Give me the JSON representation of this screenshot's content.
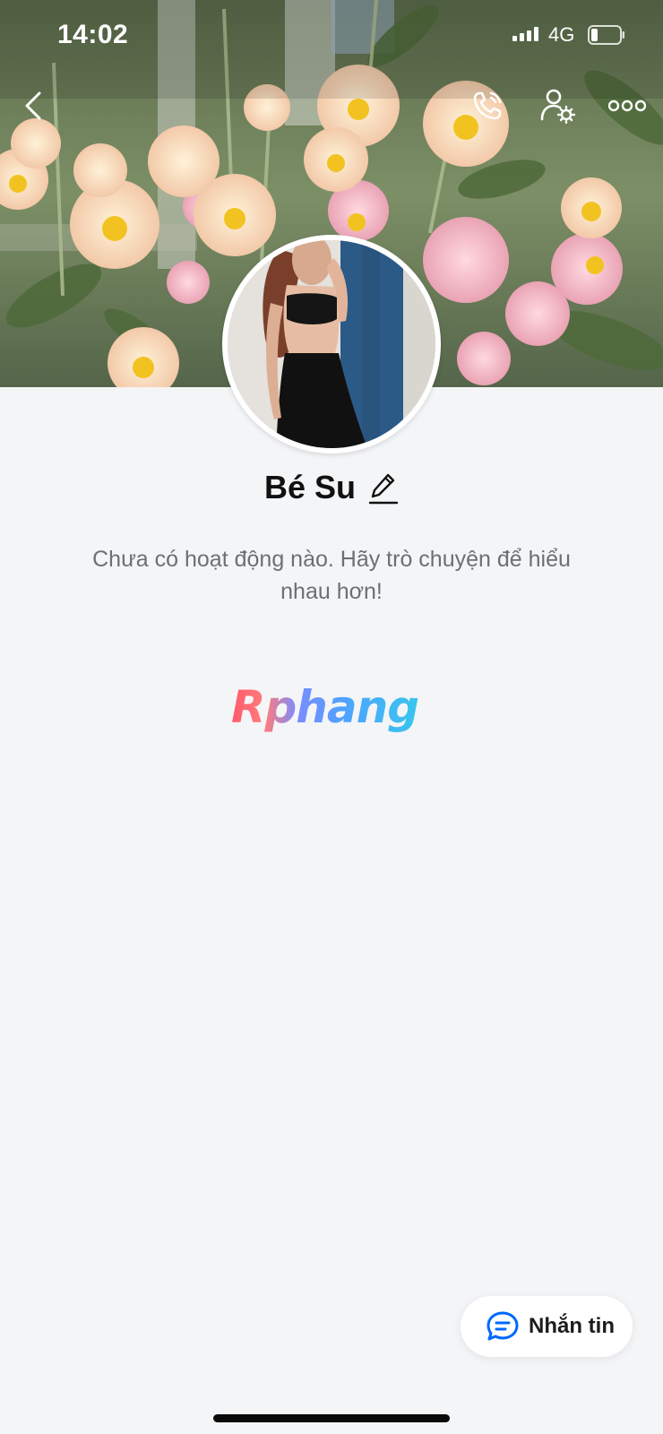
{
  "status_bar": {
    "time": "14:02",
    "network": "4G"
  },
  "nav": {
    "back_icon": "chevron-left-icon",
    "call_icon": "phone-icon",
    "friend_settings_icon": "user-gear-icon",
    "more_icon": "more-dots-icon"
  },
  "profile": {
    "name": "Bé Su",
    "edit_icon": "pencil-icon"
  },
  "feed": {
    "empty_message": "Chưa có hoạt động nào. Hãy trò chuyện để hiểu nhau hơn!"
  },
  "watermark": {
    "text": "Rphang"
  },
  "actions": {
    "message_label": "Nhắn tin",
    "message_icon": "chat-bubble-icon"
  },
  "colors": {
    "background": "#f4f5f7",
    "accent": "#0068ff",
    "text_primary": "#111111",
    "text_secondary": "#6c6f74"
  }
}
